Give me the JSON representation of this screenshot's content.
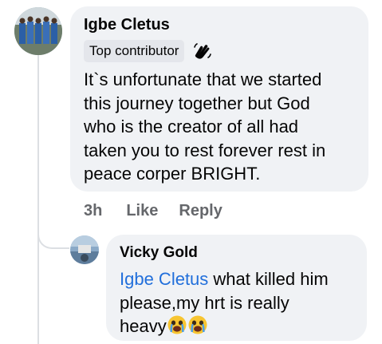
{
  "comment": {
    "author": "Igbe Cletus",
    "badge_label": "Top contributor",
    "badge_icon": "wave-hands-icon",
    "text": "It`s unfortunate that we started this journey together but God who is the creator of all had taken you to rest forever rest in peace corper BRIGHT.",
    "text_lines": [
      "It`s unfortunate that we started",
      "this journey together but God",
      "who is the creator of all had",
      "taken you to rest forever rest in",
      "peace corper BRIGHT."
    ],
    "time": "3h",
    "like_label": "Like",
    "reply_label": "Reply"
  },
  "reply": {
    "author": "Vicky Gold",
    "mention": "Igbe Cletus",
    "line1_rest": " what killed him",
    "line2": "please,my hrt is really",
    "line3": "heavy",
    "emojis": [
      "crying-face-emoji",
      "crying-face-emoji"
    ]
  },
  "colors": {
    "bubble": "#f0f2f5",
    "mention": "#216fdb",
    "meta": "#65676b",
    "text": "#050505"
  }
}
